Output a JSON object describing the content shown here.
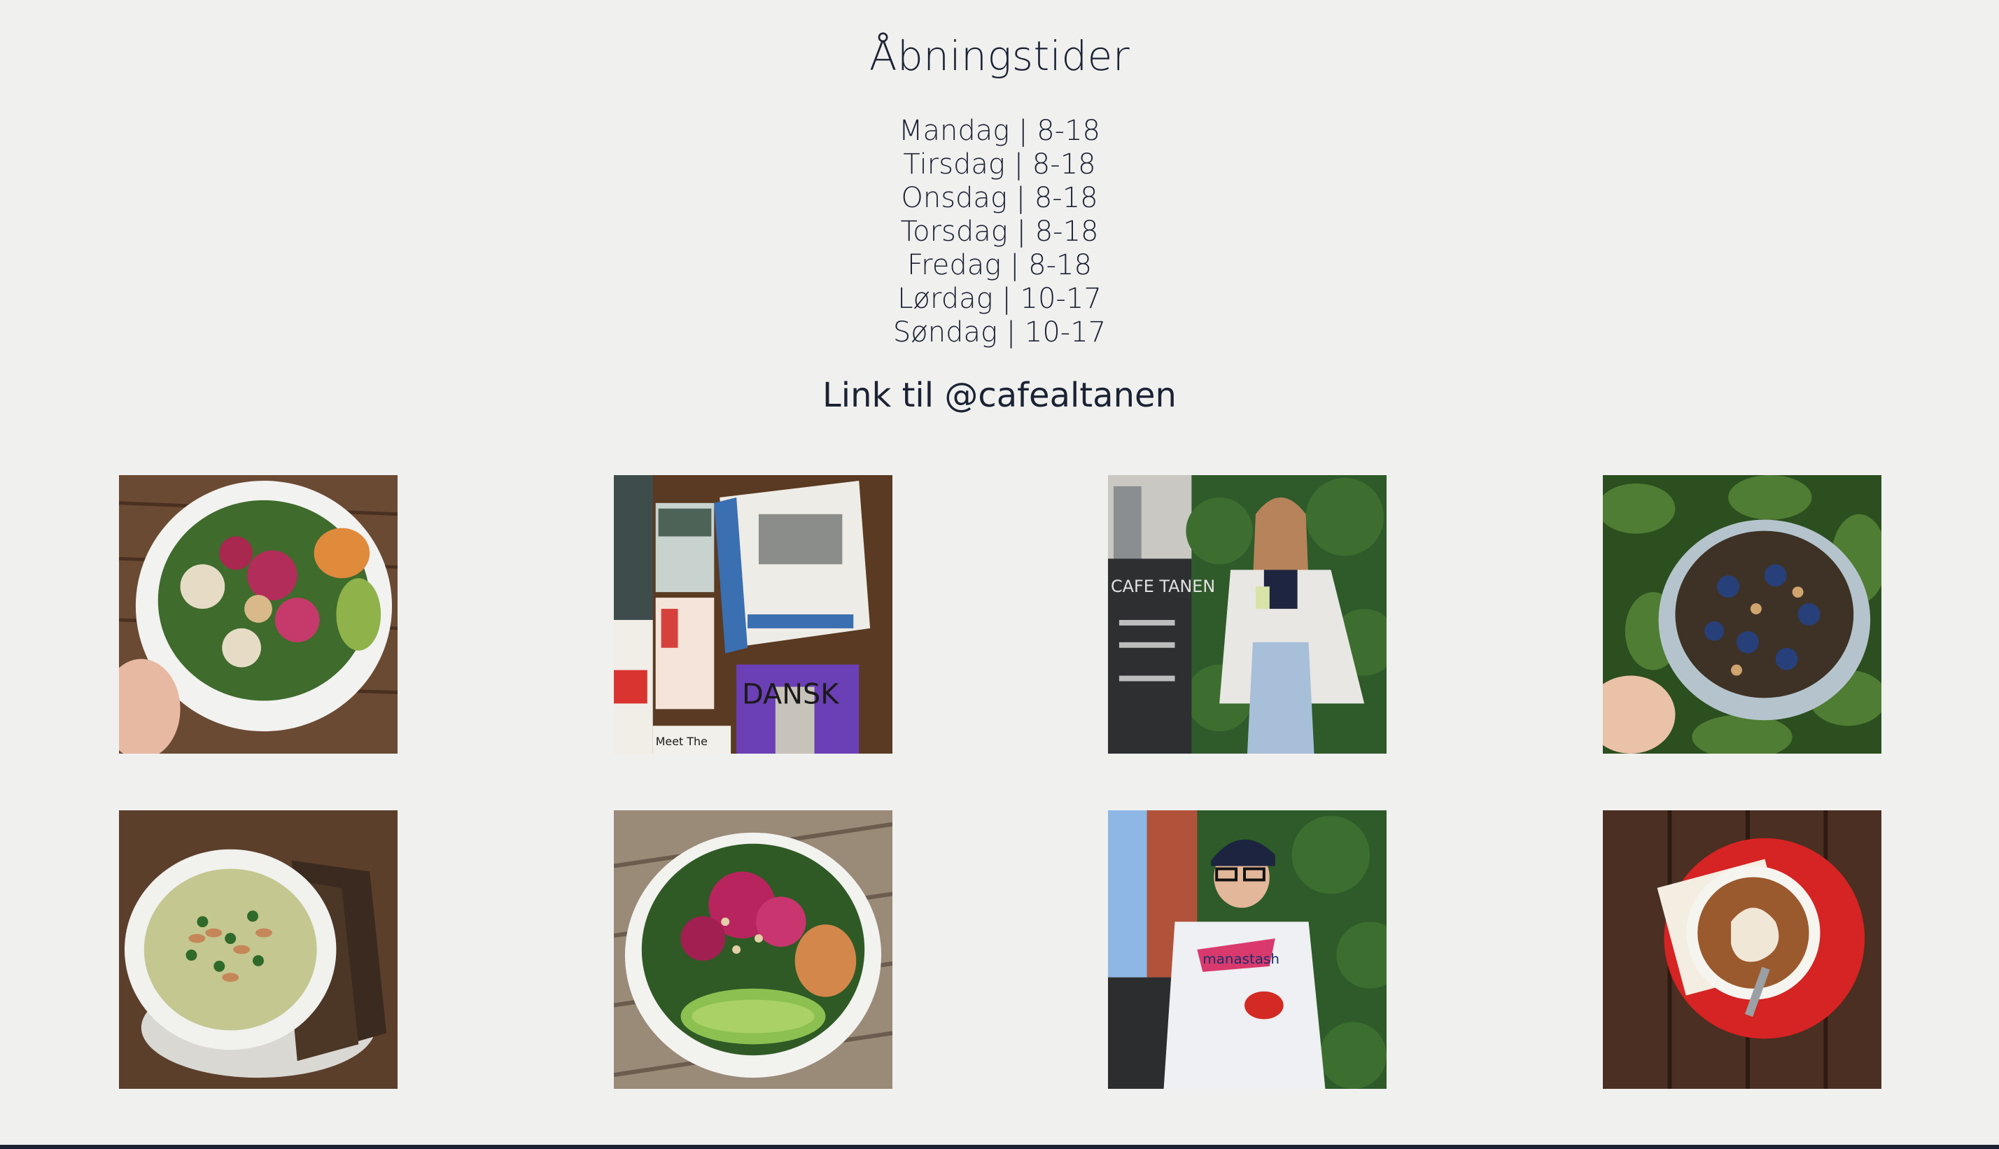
{
  "opening_hours": {
    "title": "Åbningstider",
    "days": [
      "Mandag | 8-18",
      "Tirsdag | 8-18",
      "Onsdag | 8-18",
      "Torsdag | 8-18",
      "Fredag | 8-18",
      "Lørdag | 10-17",
      "Søndag | 10-17"
    ]
  },
  "instagram": {
    "link_text": "Link til @cafealtanen",
    "photos": [
      {
        "subject": "salad-plate",
        "chalkboard_text": ""
      },
      {
        "subject": "newspapers",
        "headline": "DANSK",
        "caption": "Meet The"
      },
      {
        "subject": "woman-with-juice",
        "chalkboard_text": "CAFE TANEN"
      },
      {
        "subject": "blueberry-bowl"
      },
      {
        "subject": "soup-with-bread"
      },
      {
        "subject": "salad-bowl"
      },
      {
        "subject": "man-with-coffee",
        "shirt_text": "manastash"
      },
      {
        "subject": "latte-art"
      }
    ]
  },
  "colors": {
    "background": "#f0f0ef",
    "text": "#1b2233",
    "rule": "#1b2233"
  }
}
